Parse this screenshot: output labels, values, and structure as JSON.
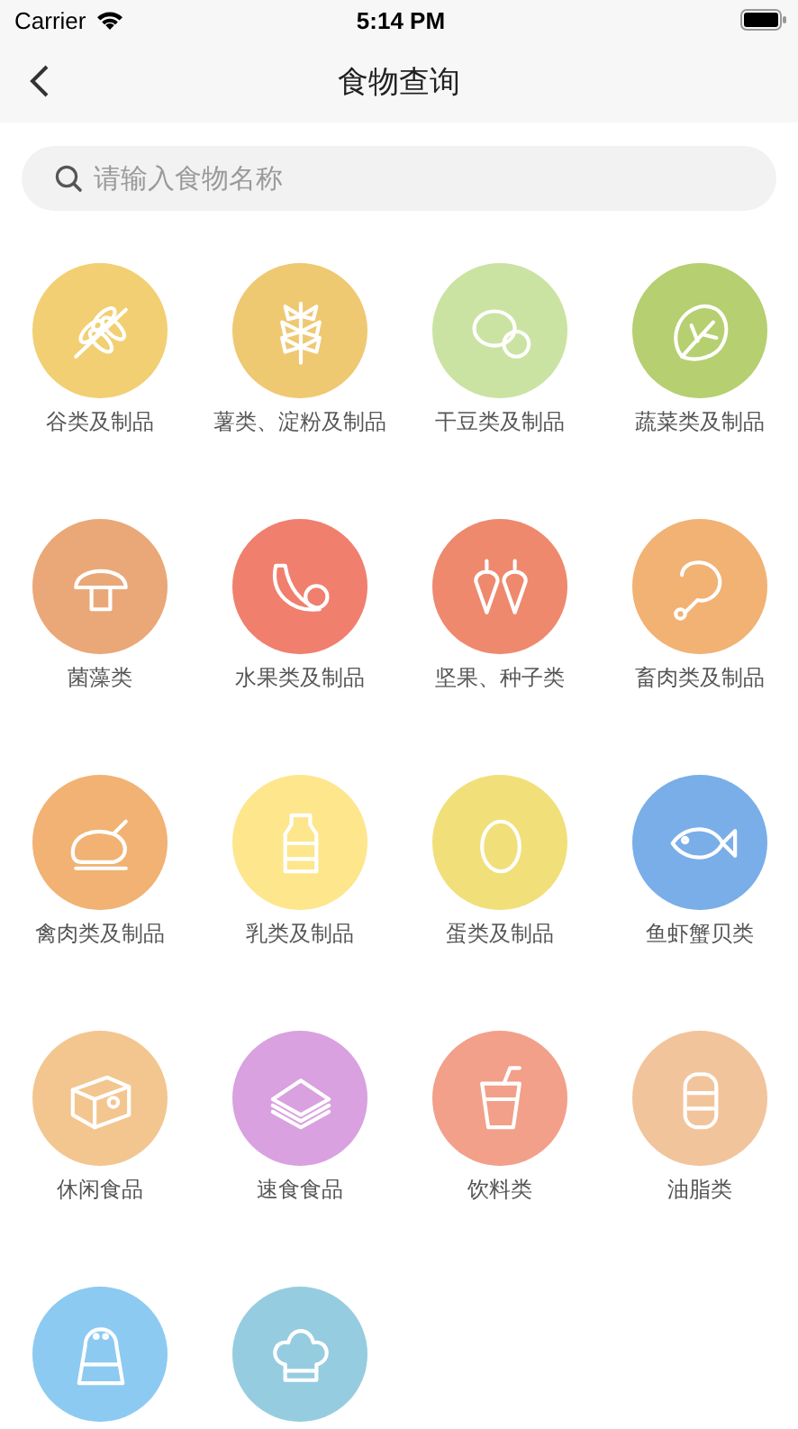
{
  "status_bar": {
    "carrier": "Carrier",
    "time": "5:14 PM"
  },
  "nav_bar": {
    "title": "食物查询"
  },
  "search": {
    "placeholder": "请输入食物名称"
  },
  "categories": [
    {
      "label": "谷类及制品",
      "color": "#f2cf72"
    },
    {
      "label": "薯类、淀粉及制品",
      "color": "#efc872"
    },
    {
      "label": "干豆类及制品",
      "color": "#cae3a2"
    },
    {
      "label": "蔬菜类及制品",
      "color": "#b6cf70"
    },
    {
      "label": "菌藻类",
      "color": "#eaa878"
    },
    {
      "label": "水果类及制品",
      "color": "#f07f6e"
    },
    {
      "label": "坚果、种子类",
      "color": "#ee896e"
    },
    {
      "label": "畜肉类及制品",
      "color": "#f1b274"
    },
    {
      "label": "禽肉类及制品",
      "color": "#f1b274"
    },
    {
      "label": "乳类及制品",
      "color": "#fde68c"
    },
    {
      "label": "蛋类及制品",
      "color": "#f1df7a"
    },
    {
      "label": "鱼虾蟹贝类",
      "color": "#79aee8"
    },
    {
      "label": "休闲食品",
      "color": "#f3c690"
    },
    {
      "label": "速食食品",
      "color": "#d9a1e0"
    },
    {
      "label": "饮料类",
      "color": "#f2a08a"
    },
    {
      "label": "油脂类",
      "color": "#f2c49c"
    },
    {
      "color": "#8ccaf2"
    },
    {
      "color": "#96cce0"
    }
  ]
}
